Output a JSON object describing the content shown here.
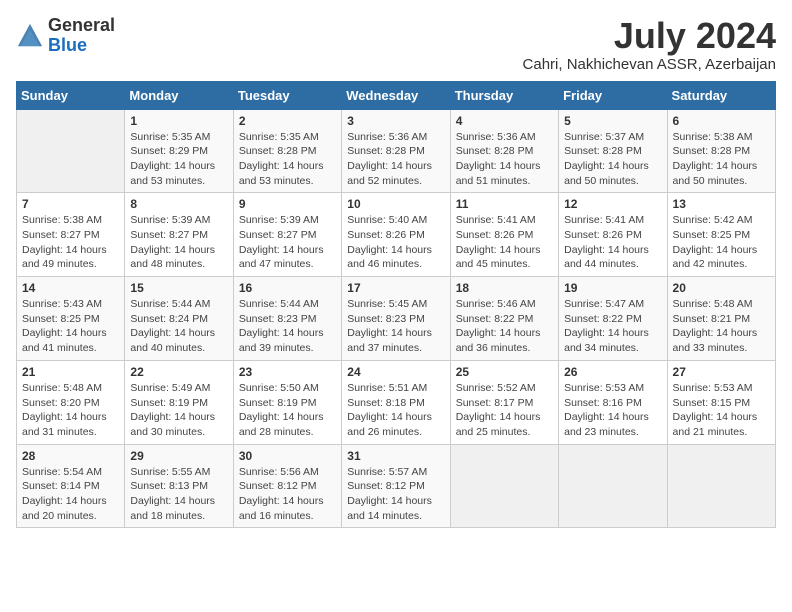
{
  "header": {
    "logo_general": "General",
    "logo_blue": "Blue",
    "month_year": "July 2024",
    "location": "Cahri, Nakhichevan ASSR, Azerbaijan"
  },
  "days_of_week": [
    "Sunday",
    "Monday",
    "Tuesday",
    "Wednesday",
    "Thursday",
    "Friday",
    "Saturday"
  ],
  "weeks": [
    [
      {
        "day": "",
        "info": ""
      },
      {
        "day": "1",
        "info": "Sunrise: 5:35 AM\nSunset: 8:29 PM\nDaylight: 14 hours\nand 53 minutes."
      },
      {
        "day": "2",
        "info": "Sunrise: 5:35 AM\nSunset: 8:28 PM\nDaylight: 14 hours\nand 53 minutes."
      },
      {
        "day": "3",
        "info": "Sunrise: 5:36 AM\nSunset: 8:28 PM\nDaylight: 14 hours\nand 52 minutes."
      },
      {
        "day": "4",
        "info": "Sunrise: 5:36 AM\nSunset: 8:28 PM\nDaylight: 14 hours\nand 51 minutes."
      },
      {
        "day": "5",
        "info": "Sunrise: 5:37 AM\nSunset: 8:28 PM\nDaylight: 14 hours\nand 50 minutes."
      },
      {
        "day": "6",
        "info": "Sunrise: 5:38 AM\nSunset: 8:28 PM\nDaylight: 14 hours\nand 50 minutes."
      }
    ],
    [
      {
        "day": "7",
        "info": "Sunrise: 5:38 AM\nSunset: 8:27 PM\nDaylight: 14 hours\nand 49 minutes."
      },
      {
        "day": "8",
        "info": "Sunrise: 5:39 AM\nSunset: 8:27 PM\nDaylight: 14 hours\nand 48 minutes."
      },
      {
        "day": "9",
        "info": "Sunrise: 5:39 AM\nSunset: 8:27 PM\nDaylight: 14 hours\nand 47 minutes."
      },
      {
        "day": "10",
        "info": "Sunrise: 5:40 AM\nSunset: 8:26 PM\nDaylight: 14 hours\nand 46 minutes."
      },
      {
        "day": "11",
        "info": "Sunrise: 5:41 AM\nSunset: 8:26 PM\nDaylight: 14 hours\nand 45 minutes."
      },
      {
        "day": "12",
        "info": "Sunrise: 5:41 AM\nSunset: 8:26 PM\nDaylight: 14 hours\nand 44 minutes."
      },
      {
        "day": "13",
        "info": "Sunrise: 5:42 AM\nSunset: 8:25 PM\nDaylight: 14 hours\nand 42 minutes."
      }
    ],
    [
      {
        "day": "14",
        "info": "Sunrise: 5:43 AM\nSunset: 8:25 PM\nDaylight: 14 hours\nand 41 minutes."
      },
      {
        "day": "15",
        "info": "Sunrise: 5:44 AM\nSunset: 8:24 PM\nDaylight: 14 hours\nand 40 minutes."
      },
      {
        "day": "16",
        "info": "Sunrise: 5:44 AM\nSunset: 8:23 PM\nDaylight: 14 hours\nand 39 minutes."
      },
      {
        "day": "17",
        "info": "Sunrise: 5:45 AM\nSunset: 8:23 PM\nDaylight: 14 hours\nand 37 minutes."
      },
      {
        "day": "18",
        "info": "Sunrise: 5:46 AM\nSunset: 8:22 PM\nDaylight: 14 hours\nand 36 minutes."
      },
      {
        "day": "19",
        "info": "Sunrise: 5:47 AM\nSunset: 8:22 PM\nDaylight: 14 hours\nand 34 minutes."
      },
      {
        "day": "20",
        "info": "Sunrise: 5:48 AM\nSunset: 8:21 PM\nDaylight: 14 hours\nand 33 minutes."
      }
    ],
    [
      {
        "day": "21",
        "info": "Sunrise: 5:48 AM\nSunset: 8:20 PM\nDaylight: 14 hours\nand 31 minutes."
      },
      {
        "day": "22",
        "info": "Sunrise: 5:49 AM\nSunset: 8:19 PM\nDaylight: 14 hours\nand 30 minutes."
      },
      {
        "day": "23",
        "info": "Sunrise: 5:50 AM\nSunset: 8:19 PM\nDaylight: 14 hours\nand 28 minutes."
      },
      {
        "day": "24",
        "info": "Sunrise: 5:51 AM\nSunset: 8:18 PM\nDaylight: 14 hours\nand 26 minutes."
      },
      {
        "day": "25",
        "info": "Sunrise: 5:52 AM\nSunset: 8:17 PM\nDaylight: 14 hours\nand 25 minutes."
      },
      {
        "day": "26",
        "info": "Sunrise: 5:53 AM\nSunset: 8:16 PM\nDaylight: 14 hours\nand 23 minutes."
      },
      {
        "day": "27",
        "info": "Sunrise: 5:53 AM\nSunset: 8:15 PM\nDaylight: 14 hours\nand 21 minutes."
      }
    ],
    [
      {
        "day": "28",
        "info": "Sunrise: 5:54 AM\nSunset: 8:14 PM\nDaylight: 14 hours\nand 20 minutes."
      },
      {
        "day": "29",
        "info": "Sunrise: 5:55 AM\nSunset: 8:13 PM\nDaylight: 14 hours\nand 18 minutes."
      },
      {
        "day": "30",
        "info": "Sunrise: 5:56 AM\nSunset: 8:12 PM\nDaylight: 14 hours\nand 16 minutes."
      },
      {
        "day": "31",
        "info": "Sunrise: 5:57 AM\nSunset: 8:12 PM\nDaylight: 14 hours\nand 14 minutes."
      },
      {
        "day": "",
        "info": ""
      },
      {
        "day": "",
        "info": ""
      },
      {
        "day": "",
        "info": ""
      }
    ]
  ]
}
